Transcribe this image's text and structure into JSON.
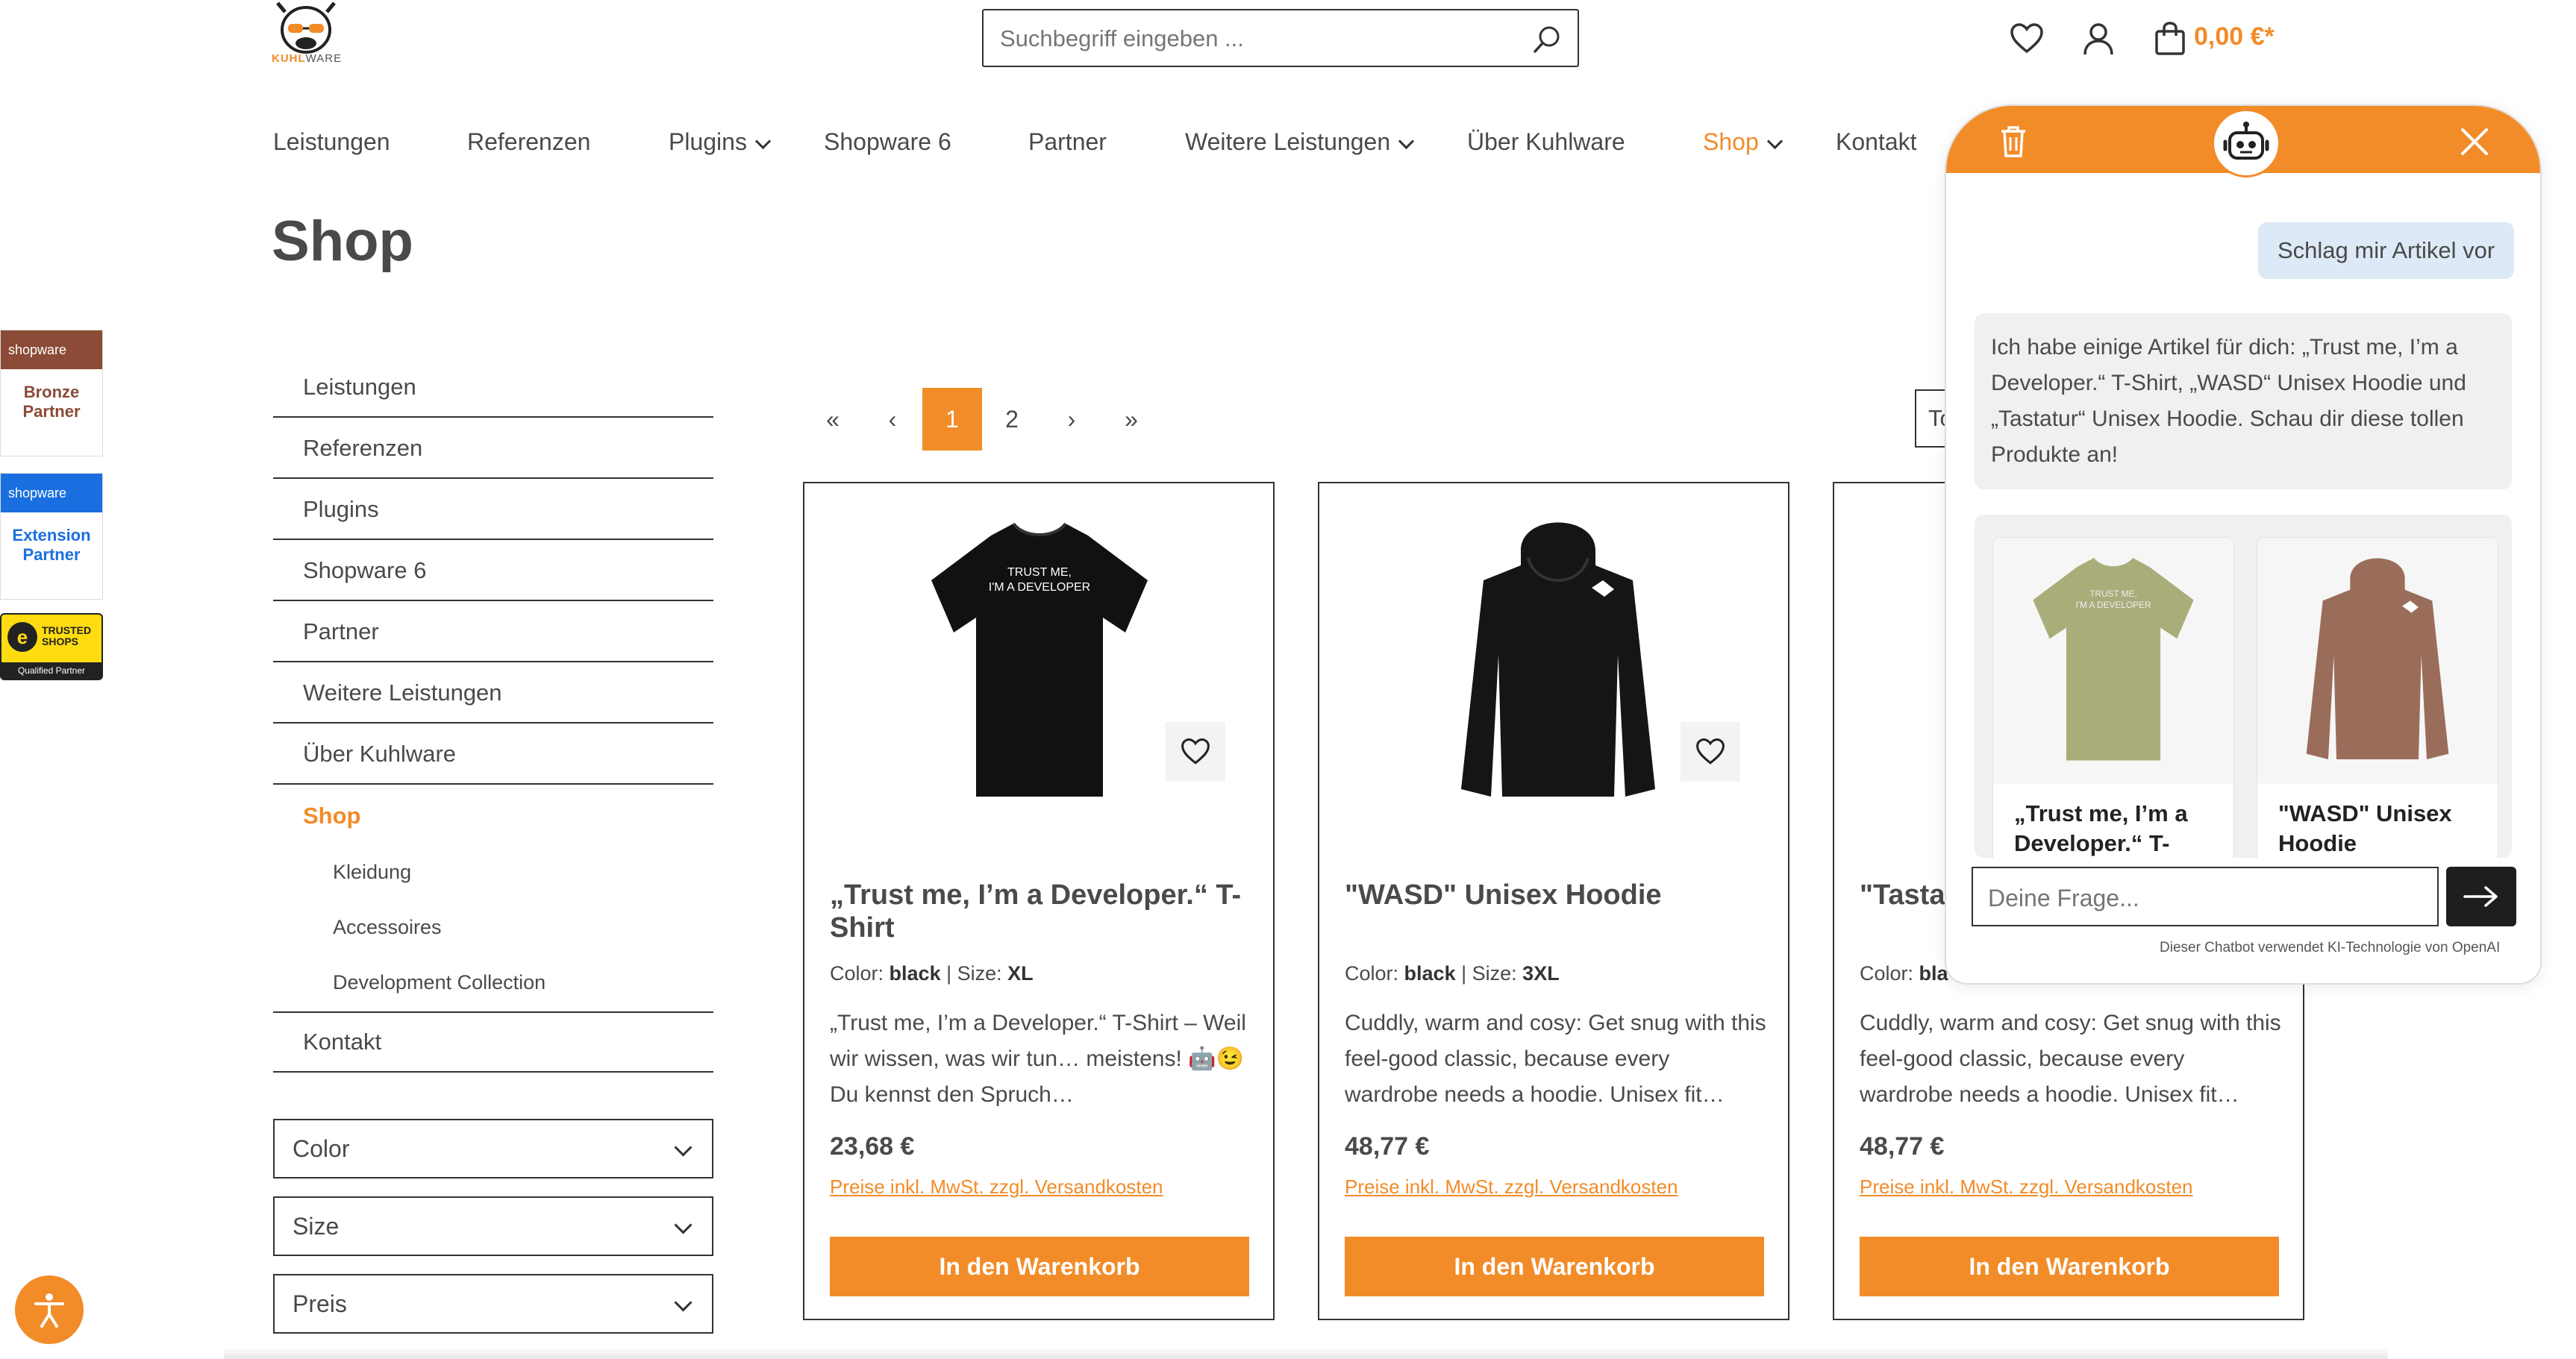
{
  "header": {
    "logo_text_a": "KUHL",
    "logo_text_b": "WARE",
    "search_placeholder": "Suchbegriff eingeben ...",
    "cart_total": "0,00 €*"
  },
  "nav": [
    {
      "label": "Leistungen",
      "dropdown": false
    },
    {
      "label": "Referenzen",
      "dropdown": false
    },
    {
      "label": "Plugins",
      "dropdown": true
    },
    {
      "label": "Shopware 6",
      "dropdown": false
    },
    {
      "label": "Partner",
      "dropdown": false
    },
    {
      "label": "Weitere Leistungen",
      "dropdown": true
    },
    {
      "label": "Über Kuhlware",
      "dropdown": false
    },
    {
      "label": "Shop",
      "dropdown": true,
      "active": true
    },
    {
      "label": "Kontakt",
      "dropdown": false
    }
  ],
  "page_title": "Shop",
  "badges": [
    {
      "brand": "shopware",
      "line1": "Bronze",
      "line2": "Partner",
      "color": "#8b4b36"
    },
    {
      "brand": "shopware",
      "line1": "Extension",
      "line2": "Partner",
      "color": "#1a6fe0"
    },
    {
      "brand": "TRUSTED SHOPS",
      "line1": "Qualified Partner",
      "color": "#ffdc0f"
    }
  ],
  "sidebar": {
    "items": [
      "Leistungen",
      "Referenzen",
      "Plugins",
      "Shopware 6",
      "Partner",
      "Weitere Leistungen",
      "Über Kuhlware",
      "Shop"
    ],
    "sub_items": [
      "Kleidung",
      "Accessoires",
      "Development Collection"
    ],
    "last_item": "Kontakt",
    "filters": [
      "Color",
      "Size",
      "Preis"
    ]
  },
  "pagination": {
    "first": "«",
    "prev": "‹",
    "pages": [
      "1",
      "2"
    ],
    "current": "1",
    "next": "›",
    "last": "»"
  },
  "sort_label_partial": "To",
  "products": [
    {
      "name": "„Trust me, I’m a Developer.“ T-Shirt",
      "color_label": "Color:",
      "color": "black",
      "size_label": "Size:",
      "size": "XL",
      "description": "„Trust me, I’m a Developer.“ T-Shirt – Weil wir wissen, was wir tun… meistens! 🤖😉Du kennst den Spruch…",
      "price": "23,68 €",
      "tax_note": "Preise inkl. MwSt. zzgl. Versandkosten",
      "button": "In den Warenkorb"
    },
    {
      "name": "\"WASD\" Unisex Hoodie",
      "color_label": "Color:",
      "color": "black",
      "size_label": "Size:",
      "size": "3XL",
      "description": "Cuddly, warm and cosy: Get snug with this feel-good classic, because every wardrobe needs a hoodie. Unisex fit…",
      "price": "48,77 €",
      "tax_note": "Preise inkl. MwSt. zzgl. Versandkosten",
      "button": "In den Warenkorb"
    },
    {
      "name": "\"Tastat",
      "color_label": "Color:",
      "color": "bla",
      "size_label": "",
      "size": "",
      "description": "Cuddly, warm and cosy: Get snug with this feel-good classic, because every wardrobe needs a hoodie. Unisex fit…",
      "price": "48,77 €",
      "tax_note": "Preise inkl. MwSt. zzgl. Versandkosten",
      "button": "In den Warenkorb"
    }
  ],
  "chatbot": {
    "user_message": "Schlag mir Artikel vor",
    "bot_message": "Ich habe einige Artikel für dich: „Trust me, I’m a Developer.“ T-Shirt, „WASD“ Unisex Hoodie und „Tastatur“ Unisex Hoodie. Schau dir diese tollen Produkte an!",
    "recommendations": [
      {
        "name": "„Trust me, I’m a Developer.“ T-"
      },
      {
        "name": "\"WASD\" Unisex Hoodie"
      }
    ],
    "input_placeholder": "Deine Frage...",
    "disclaimer": "Dieser Chatbot verwendet KI-Technologie von OpenAI",
    "accent_color": "#f28c28"
  },
  "colors": {
    "accent": "#f28c28",
    "text": "#4a4a4a"
  }
}
